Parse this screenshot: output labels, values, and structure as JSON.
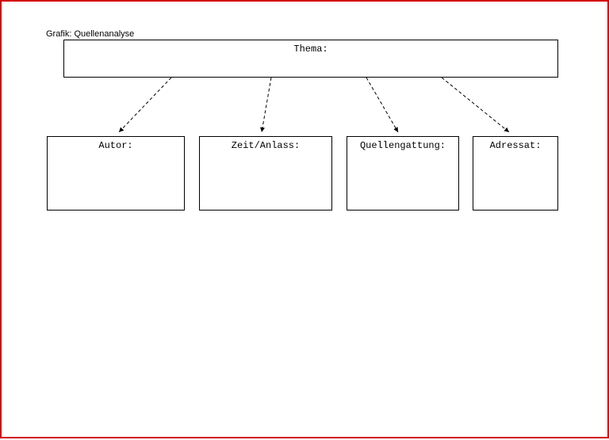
{
  "title": "Grafik: Quellenanalyse",
  "boxes": {
    "thema": "Thema:",
    "autor": "Autor:",
    "zeit": "Zeit/Anlass:",
    "quellen": "Quellengattung:",
    "adressat": "Adressat:"
  }
}
